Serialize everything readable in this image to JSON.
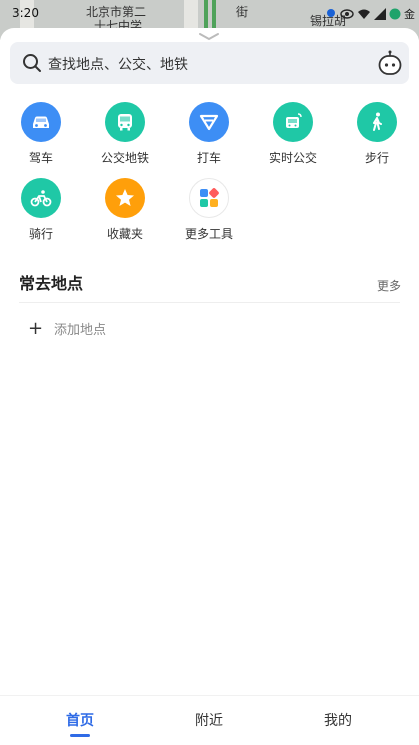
{
  "status_bar": {
    "time": "3:20",
    "carrier_text": "金"
  },
  "map": {
    "labels": [
      "北京市第二",
      "十七中学",
      "锡拉胡",
      "街"
    ]
  },
  "search": {
    "placeholder": "查找地点、公交、地铁"
  },
  "quick_actions": [
    {
      "label": "驾车",
      "icon": "car-icon",
      "color": "#3d8ef5"
    },
    {
      "label": "公交地铁",
      "icon": "bus-icon",
      "color": "#1fc8a6"
    },
    {
      "label": "打车",
      "icon": "taxi-icon",
      "color": "#3d8ef5"
    },
    {
      "label": "实时公交",
      "icon": "realtime-bus-icon",
      "color": "#1fc8a6"
    },
    {
      "label": "步行",
      "icon": "walk-icon",
      "color": "#1fc8a6"
    },
    {
      "label": "骑行",
      "icon": "bike-icon",
      "color": "#1fc8a6"
    },
    {
      "label": "收藏夹",
      "icon": "star-icon",
      "color": "#ff9f0a"
    },
    {
      "label": "更多工具",
      "icon": "apps-icon",
      "color": "#ffffff"
    }
  ],
  "frequent_places": {
    "title": "常去地点",
    "more_label": "更多",
    "add_label": "添加地点"
  },
  "tabs": [
    {
      "label": "首页",
      "active": true
    },
    {
      "label": "附近",
      "active": false
    },
    {
      "label": "我的",
      "active": false
    }
  ],
  "colors": {
    "accent": "#2f6be6"
  }
}
